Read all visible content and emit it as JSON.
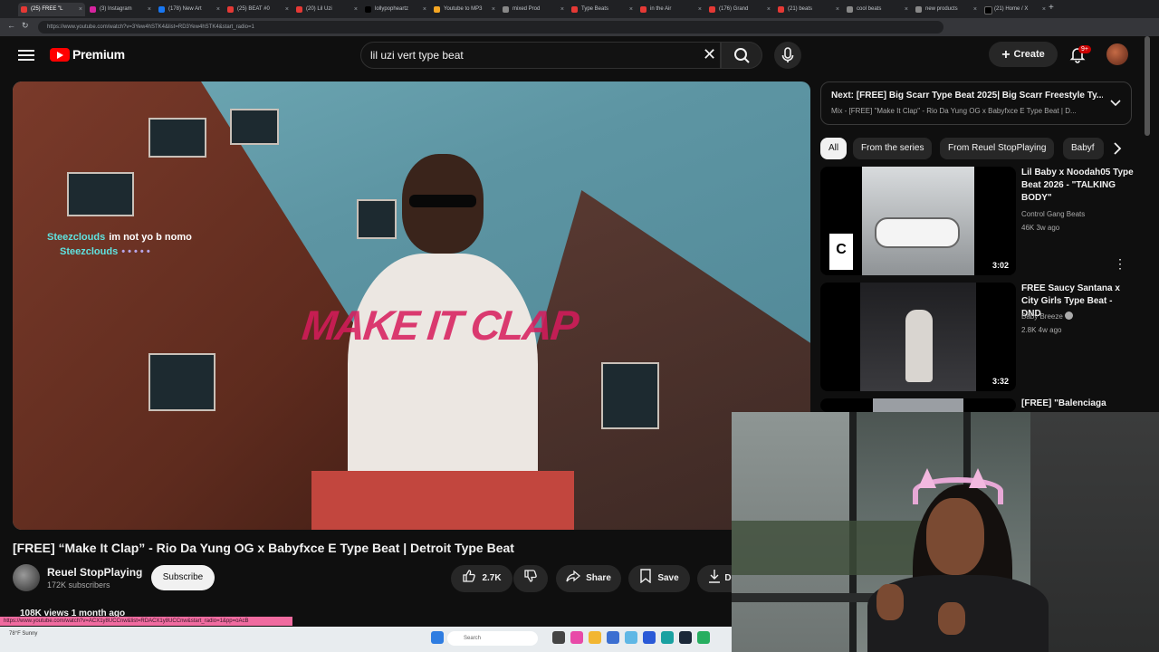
{
  "browser": {
    "tabs": [
      {
        "label": "(25) FREE \"L"
      },
      {
        "label": "(3) Instagram"
      },
      {
        "label": "(178) New Art"
      },
      {
        "label": "(25) BEAT #0"
      },
      {
        "label": "(20) Lil Uzi"
      },
      {
        "label": "lollypopheartz"
      },
      {
        "label": "Youtube to MP3"
      },
      {
        "label": "mixed Prod"
      },
      {
        "label": "Type Beats"
      },
      {
        "label": "in the Air"
      },
      {
        "label": "(176) Grand"
      },
      {
        "label": "(21) beats"
      },
      {
        "label": "cool beats"
      },
      {
        "label": "new products"
      },
      {
        "label": "(21) Home / X"
      }
    ],
    "url": "https://www.youtube.com/watch?v=3Yew4hSTK4&list=RD3Yew4hSTK4&start_radio=1",
    "status_url": "https://www.youtube.com/watch?v=ACX1y8UCCnw&list=RDACX1y8UCCnw&start_radio=1&pp=oAcB"
  },
  "header": {
    "brand": "Premium",
    "search_value": "lil uzi vert type beat",
    "create_label": "Create",
    "notif_count": "9+"
  },
  "video": {
    "overlay_title": "MAKE IT CLAP",
    "chat": [
      {
        "user": "Steezclouds",
        "message": "im not yo b nomo"
      },
      {
        "user": "Steezclouds",
        "message": "• • • • •"
      }
    ],
    "title": "[FREE] “Make It Clap” - Rio Da Yung OG x Babyfxce E Type Beat | Detroit Type Beat",
    "views": "108K views  1 month ago"
  },
  "channel": {
    "name": "Reuel StopPlaying",
    "subs": "172K subscribers",
    "subscribe_label": "Subscribe"
  },
  "actions": {
    "likes": "2.7K",
    "share": "Share",
    "save": "Save",
    "download": "D"
  },
  "sidebar": {
    "next_title": "Next: [FREE] Big Scarr Type Beat 2025| Big Scarr Freestyle Ty...",
    "next_sub": "Mix - [FREE] \"Make It Clap\" - Rio Da Yung OG x Babyfxce E Type Beat | D...",
    "chips": [
      {
        "label": "All"
      },
      {
        "label": "From the series"
      },
      {
        "label": "From Reuel StopPlaying"
      },
      {
        "label": "Babyf"
      }
    ],
    "videos": [
      {
        "title": "Lil Baby x Noodah05 Type Beat 2026 - \"TALKING BODY\"",
        "channel": "Control Gang Beats",
        "meta": "46K  3w ago",
        "duration": "3:02"
      },
      {
        "title": "FREE Saucy Santana x City Girls Type Beat - DND",
        "channel": "Baby Breeze",
        "meta": "2.8K  4w ago",
        "duration": "3:32"
      },
      {
        "title": "[FREE] \"Balenciaga Store\"",
        "channel": "",
        "meta": "",
        "duration": ""
      }
    ]
  },
  "taskbar": {
    "weather": "78°F Sunny",
    "search_placeholder": "Search"
  },
  "colors": {
    "brand_red": "#ff0000",
    "chat_user": "#5fe3e0",
    "status_pink": "#f06ba0"
  }
}
